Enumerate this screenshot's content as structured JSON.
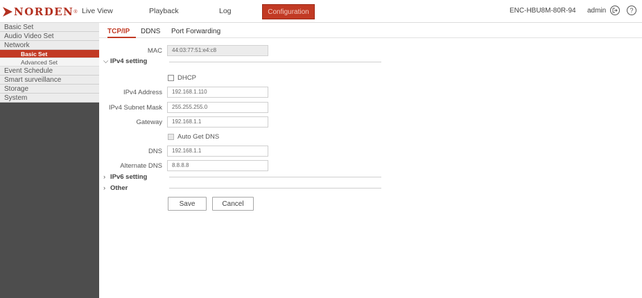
{
  "header": {
    "brand": "NORDEN",
    "brand_mark": "®",
    "nav": [
      "Live View",
      "Playback",
      "Log",
      "Configuration"
    ],
    "device_name": "ENC-HBU8M-80R-94",
    "user": "admin",
    "logout_icon": "logout-icon",
    "help_icon": "help-icon",
    "accent_color": "#c23a24"
  },
  "sidebar": {
    "items": [
      {
        "label": "Basic Set"
      },
      {
        "label": "Audio Video Set"
      },
      {
        "label": "Network"
      },
      {
        "label": "Basic Set",
        "sub": true,
        "active": true
      },
      {
        "label": "Advanced Set",
        "sub": true
      },
      {
        "label": "Event Schedule"
      },
      {
        "label": "Smart surveillance"
      },
      {
        "label": "Storage"
      },
      {
        "label": "System"
      }
    ]
  },
  "tabs": [
    "TCP/IP",
    "DDNS",
    "Port Forwarding"
  ],
  "form": {
    "mac_label": "MAC",
    "mac_value": "44:03:77:51:e4:c8",
    "ipv4_section": "IPv4 setting",
    "dhcp_label": "DHCP",
    "ipv4_address_label": "IPv4 Address",
    "ipv4_address_value": "192.168.1.110",
    "subnet_label": "IPv4 Subnet Mask",
    "subnet_value": "255.255.255.0",
    "gateway_label": "Gateway",
    "gateway_value": "192.168.1.1",
    "auto_dns_label": "Auto Get DNS",
    "dns_label": "DNS",
    "dns_value": "192.168.1.1",
    "alt_dns_label": "Alternate DNS",
    "alt_dns_value": "8.8.8.8",
    "ipv6_section": "IPv6 setting",
    "other_section": "Other",
    "save_label": "Save",
    "cancel_label": "Cancel"
  }
}
